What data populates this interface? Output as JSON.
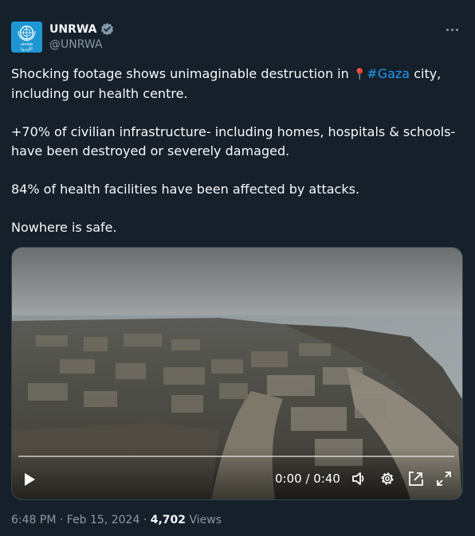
{
  "author": {
    "name": "UNRWA",
    "handle": "@UNRWA",
    "avatar_text_en": "unrwa",
    "avatar_text_ar": "الأونروا"
  },
  "tweet": {
    "line1_before": "Shocking footage shows unimaginable destruction in ",
    "pin_icon": "📍",
    "hashtag": "#Gaza",
    "line1_after": " city, including our health centre.",
    "para2": "+70% of civilian infrastructure- including homes, hospitals & schools- have been destroyed or severely damaged.",
    "para3": "84% of health facilities have been affected by attacks.",
    "para4": "Nowhere is safe."
  },
  "video": {
    "time": "0:00 / 0:40",
    "progress": 0
  },
  "meta": {
    "time": "6:48 PM",
    "date": "Feb 15, 2024",
    "sep": " · ",
    "views_count": "4,702",
    "views_label": "Views"
  },
  "colors": {
    "background": "#15202b",
    "accent": "#1d9bf0",
    "muted": "#8b98a5"
  }
}
